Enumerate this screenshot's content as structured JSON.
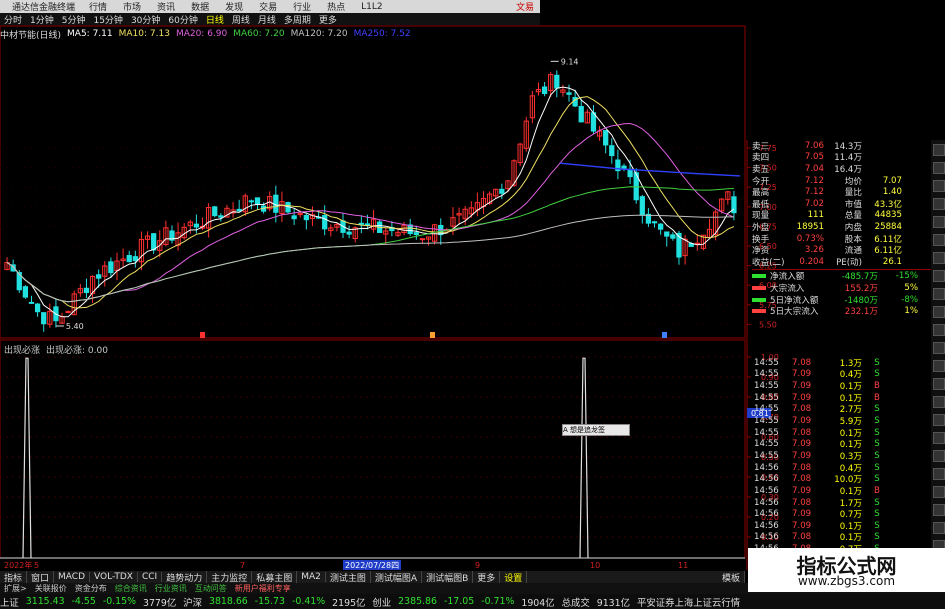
{
  "app": {
    "title": "通达信金融终端",
    "menu": [
      "行情",
      "市场",
      "资讯",
      "数据",
      "发现",
      "交易",
      "行业",
      "热点",
      "L1L2"
    ],
    "brand": "文易"
  },
  "periods": [
    "分时",
    "1分钟",
    "5分钟",
    "15分钟",
    "30分钟",
    "60分钟",
    "日线",
    "周线",
    "月线",
    "多周期",
    "更多"
  ],
  "active_period": "日线",
  "ma_line": {
    "stock": "中材节能(日线)",
    "items": [
      {
        "label": "MA5: 7.11",
        "color": "#ffffff"
      },
      {
        "label": "MA10: 7.13",
        "color": "#f0e060"
      },
      {
        "label": "MA20: 6.90",
        "color": "#e060e0"
      },
      {
        "label": "MA60: 7.20",
        "color": "#40d040"
      },
      {
        "label": "MA120: 7.20",
        "color": "#c0c0c0"
      },
      {
        "label": "MA250: 7.52",
        "color": "#4040ff"
      }
    ]
  },
  "price_axis": [
    "7.75",
    "7.50",
    "7.25",
    "7.00",
    "6.75",
    "6.50",
    "6.25",
    "6.00",
    "5.75",
    "5.50"
  ],
  "annotations": {
    "high": "9.14",
    "low": "5.40"
  },
  "indicator_line": {
    "name": "出现必涨",
    "label": "出现必涨: 0.00"
  },
  "ind_axis": [
    "1.00",
    "0.90",
    "0.80",
    "0.70",
    "0.60",
    "0.50",
    "0.40",
    "0.30",
    "0.20",
    "0.10"
  ],
  "ind_marker": "0.81",
  "date_axis": [
    "2022年",
    "5",
    "7",
    "2022/07/28四",
    "9",
    "10",
    "11"
  ],
  "popup": "A 想是追龙签",
  "quote": [
    {
      "label": "卖三",
      "price": "7.06",
      "vol": "14.3万"
    },
    {
      "label": "卖四",
      "price": "7.05",
      "vol": "11.4万"
    },
    {
      "label": "卖五",
      "price": "7.04",
      "vol": "16.4万"
    },
    {
      "label": "今开",
      "price": "7.12",
      "vol": "均价",
      "extra": "7.07"
    },
    {
      "label": "最高",
      "price": "7.12",
      "vol": "量比",
      "extra": "1.40"
    },
    {
      "label": "最低",
      "price": "7.02",
      "vol": "市值",
      "extra": "43.3亿"
    },
    {
      "label": "现量",
      "price": "111",
      "vol": "总量",
      "extra": "44835"
    },
    {
      "label": "外盘",
      "price": "18951",
      "vol": "内盘",
      "extra": "25884"
    },
    {
      "label": "换手",
      "price": "0.73%",
      "vol": "股本",
      "extra": "6.11亿"
    },
    {
      "label": "净资",
      "price": "3.26",
      "vol": "流通",
      "extra": "6.11亿"
    },
    {
      "label": "收益(二)",
      "price": "0.204",
      "vol": "PE(动)",
      "extra": "26.1"
    },
    {
      "label": "净流入额",
      "price": "-485.7万",
      "vol": "",
      "extra": "-15%"
    },
    {
      "label": "大宗流入",
      "price": "155.2万",
      "vol": "",
      "extra": "5%"
    },
    {
      "label": "5日净流入额",
      "price": "-1480万",
      "vol": "",
      "extra": "-8%"
    },
    {
      "label": "5日大宗流入",
      "price": "232.1万",
      "vol": "",
      "extra": "1%"
    }
  ],
  "ticks": [
    {
      "t": "14:55",
      "p": "7.08",
      "v": "1.3万",
      "s": "S"
    },
    {
      "t": "14:55",
      "p": "7.09",
      "v": "0.4万",
      "s": "S"
    },
    {
      "t": "14:55",
      "p": "7.09",
      "v": "0.1万",
      "s": "B"
    },
    {
      "t": "14:55",
      "p": "7.09",
      "v": "0.1万",
      "s": "B"
    },
    {
      "t": "14:55",
      "p": "7.08",
      "v": "2.7万",
      "s": "S"
    },
    {
      "t": "14:55",
      "p": "7.09",
      "v": "5.9万",
      "s": "S"
    },
    {
      "t": "14:55",
      "p": "7.08",
      "v": "0.1万",
      "s": "S"
    },
    {
      "t": "14:55",
      "p": "7.09",
      "v": "0.1万",
      "s": "S"
    },
    {
      "t": "14:55",
      "p": "7.09",
      "v": "0.3万",
      "s": "S"
    },
    {
      "t": "14:56",
      "p": "7.08",
      "v": "0.4万",
      "s": "S"
    },
    {
      "t": "14:56",
      "p": "7.08",
      "v": "10.0万",
      "s": "S"
    },
    {
      "t": "14:56",
      "p": "7.09",
      "v": "0.1万",
      "s": "B"
    },
    {
      "t": "14:56",
      "p": "7.08",
      "v": "1.7万",
      "s": "S"
    },
    {
      "t": "14:56",
      "p": "7.09",
      "v": "0.7万",
      "s": "S"
    },
    {
      "t": "14:56",
      "p": "7.09",
      "v": "0.1万",
      "s": "S"
    },
    {
      "t": "14:56",
      "p": "7.08",
      "v": "0.1万",
      "s": "S"
    },
    {
      "t": "14:56",
      "p": "7.08",
      "v": "0.7万",
      "s": "S"
    }
  ],
  "tabs": [
    "指标",
    "窗口",
    "MACD",
    "VOL-TDX",
    "CCI",
    "趋势动力",
    "主力监控",
    "私募主图",
    "MA2",
    "测试主图",
    "测试幅图A",
    "测试幅图B",
    "更多",
    "设置"
  ],
  "active_tab": "设置",
  "tab_extra": "模板",
  "tabs2": [
    "扩展>",
    "关联报价",
    "资金分布",
    "综合资讯",
    "行业资讯",
    "互动问答",
    "新用户福利专享"
  ],
  "status": [
    {
      "name": "上证",
      "value": "3115.43",
      "chg": "-4.55",
      "pct": "-0.15%",
      "amt": "3779亿"
    },
    {
      "name": "沪深",
      "value": "3818.66",
      "chg": "-15.73",
      "pct": "-0.41%",
      "amt": "2195亿"
    },
    {
      "name": "创业",
      "value": "2385.86",
      "chg": "-17.05",
      "pct": "-0.71%",
      "amt": "1904亿"
    }
  ],
  "status_total": {
    "label": "总成交",
    "value": "9131亿"
  },
  "status_right": "平安证券上海上证云行情",
  "watermark": {
    "line1": "指标公式网",
    "line2": "www.zbgs3.com"
  },
  "colors": {
    "up": "#ff3030",
    "down": "#20e0e0",
    "grid": "#8b0000",
    "signal": "#e0e0e0"
  }
}
